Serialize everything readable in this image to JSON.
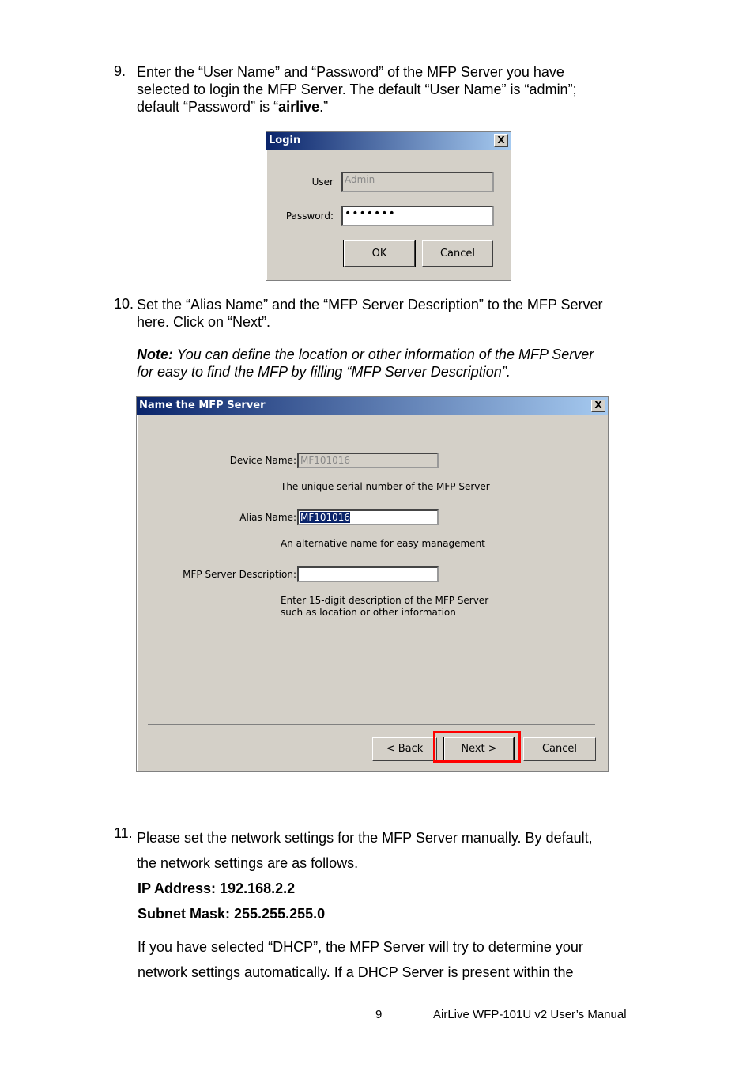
{
  "step9": {
    "num": "9.",
    "line1": "Enter the “User Name” and “Password” of the MFP Server you have",
    "line2": "selected to login the MFP Server. The default “User Name” is “admin”;",
    "line3_pre": "default “Password” is “",
    "line3_bold": "airlive",
    "line3_post": ".”"
  },
  "login": {
    "title": "Login",
    "close": "X",
    "user_label": "User",
    "user_value": "Admin",
    "password_label": "Password:",
    "password_value": "•••••••",
    "ok": "OK",
    "cancel": "Cancel"
  },
  "step10": {
    "num": "10.",
    "line1": "Set the “Alias Name” and the “MFP Server Description” to the MFP Server",
    "line2": "here. Click on “Next”.",
    "note_label": "Note:",
    "note_line1": " You can define the location or other information of the MFP Server",
    "note_line2": "for easy to find the MFP by filling “MFP Server Description”."
  },
  "name_dialog": {
    "title": "Name the MFP Server",
    "close": "X",
    "device_label": "Device Name:",
    "device_value": "MF101016",
    "device_hint": "The unique serial number of the MFP Server",
    "alias_label": "Alias Name:",
    "alias_value": "MF101016",
    "alias_hint": "An alternative name for easy management",
    "desc_label": "MFP Server Description:",
    "desc_value": "",
    "desc_hint1": "Enter 15-digit description of the MFP Server",
    "desc_hint2": "such as location or other information",
    "back": "< Back",
    "next": "Next >",
    "cancel": "Cancel",
    "highlight_color": "#ff0000"
  },
  "step11": {
    "num": "11.",
    "line1": "Please set the network settings for the MFP Server manually. By default,",
    "line2": "the network settings are as follows.",
    "ip": "IP Address: 192.168.2.2",
    "mask": "Subnet Mask: 255.255.255.0",
    "dhcp1": "If you have selected “DHCP”, the MFP Server will try to determine your",
    "dhcp2": "network settings automatically. If a DHCP Server is present within the"
  },
  "footer": {
    "page": "9",
    "manual": "AirLive WFP-101U v2 User’s Manual"
  }
}
